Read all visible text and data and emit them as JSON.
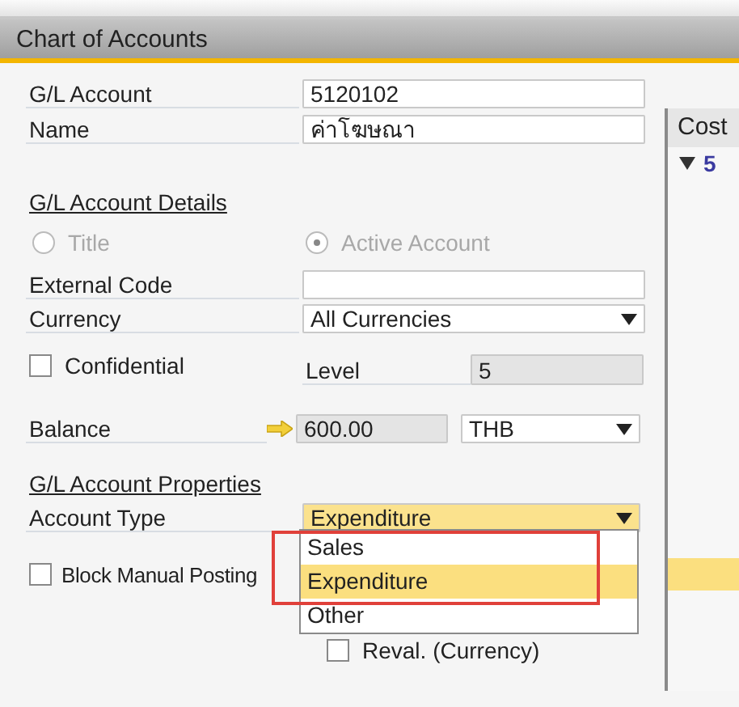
{
  "window": {
    "title": "Chart of Accounts"
  },
  "fields": [
    {
      "label": "G/L Account",
      "value": "5120102"
    },
    {
      "label": "Name",
      "value": "ค่าโฆษณา"
    }
  ],
  "details": {
    "heading": "G/L Account Details",
    "radios": [
      {
        "label": "Title",
        "selected": false,
        "disabled": true
      },
      {
        "label": "Active Account",
        "selected": true,
        "disabled": true
      }
    ],
    "external_code": {
      "label": "External Code"
    },
    "currency": {
      "label": "Currency",
      "value": "All Currencies"
    },
    "confidential": {
      "label": "Confidential",
      "checked": false
    },
    "level": {
      "label": "Level",
      "value": "5"
    },
    "balance": {
      "label": "Balance",
      "value": "600.00",
      "currency": "THB"
    }
  },
  "properties": {
    "heading": "G/L Account Properties",
    "account_type": {
      "label": "Account Type",
      "value": "Expenditure",
      "options": [
        {
          "label": "Sales",
          "selected": false
        },
        {
          "label": "Expenditure",
          "selected": true
        },
        {
          "label": "Other",
          "selected": false
        }
      ]
    },
    "block_manual_posting": {
      "label": "Block Manual Posting",
      "checked": false
    },
    "reval_currency": {
      "label": "Reval. (Currency)",
      "checked": false
    }
  },
  "right_panel": {
    "header": "Cost",
    "tree_item": "5"
  }
}
